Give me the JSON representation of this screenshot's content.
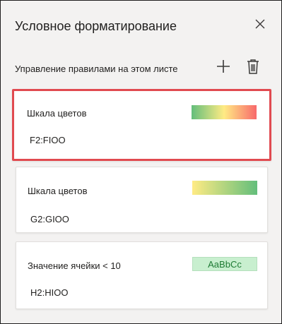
{
  "panel": {
    "title": "Условное форматирование",
    "subheader": "Управление правилами на этом листе"
  },
  "toolbar": {
    "add_icon": "plus-icon",
    "delete_icon": "trash-icon",
    "close_icon": "close-icon"
  },
  "rules": [
    {
      "name": "Шкала цветов",
      "range": "F2:FIOO",
      "preview": "gradient-green-yellow-red",
      "selected": true
    },
    {
      "name": "Шкала цветов",
      "range": "G2:GIOO",
      "preview": "gradient-yellow-green",
      "selected": false
    },
    {
      "name": "Значение ячейки < 10",
      "range": "H2:HIOO",
      "preview_text": "AaBbCc",
      "selected": false
    }
  ],
  "colors": {
    "selection_border": "#e14a50",
    "scale_green": "#63be7b",
    "scale_yellow": "#ffeb84",
    "scale_red": "#f8696b",
    "highlight_fill": "#c8efcf",
    "highlight_text": "#1e7b34"
  }
}
